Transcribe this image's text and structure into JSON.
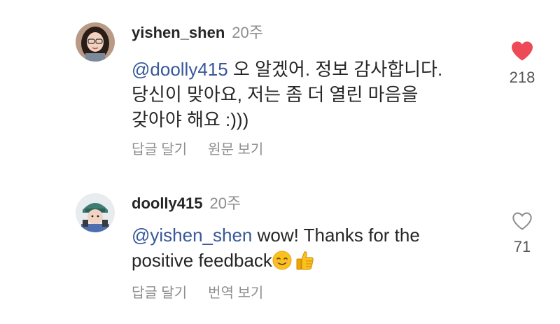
{
  "comments": [
    {
      "username": "yishen_shen",
      "time": "20주",
      "mention": "@doolly415",
      "text_line1_rest": " 오 알겠어. 정보 감사합니다.",
      "text_line2": "당신이 맞아요, 저는 좀 더 열린 마음을",
      "text_line3": "갖아야 해요 :)))",
      "reply_label": "답글 달기",
      "secondary_label": "원문 보기",
      "likes": "218",
      "liked": true
    },
    {
      "username": "doolly415",
      "time": "20주",
      "mention": "@yishen_shen",
      "text_line1_rest": " wow! Thanks for the",
      "text_line2": "positive feedback",
      "reply_label": "답글 달기",
      "secondary_label": "번역 보기",
      "likes": "71",
      "liked": false
    }
  ],
  "colors": {
    "heart_filled": "#ed4956",
    "mention": "#385898",
    "muted": "#8e8e8e"
  },
  "icons": [
    "heart-filled-icon",
    "heart-outline-icon",
    "smiling-face-emoji",
    "thumbs-up-emoji"
  ]
}
